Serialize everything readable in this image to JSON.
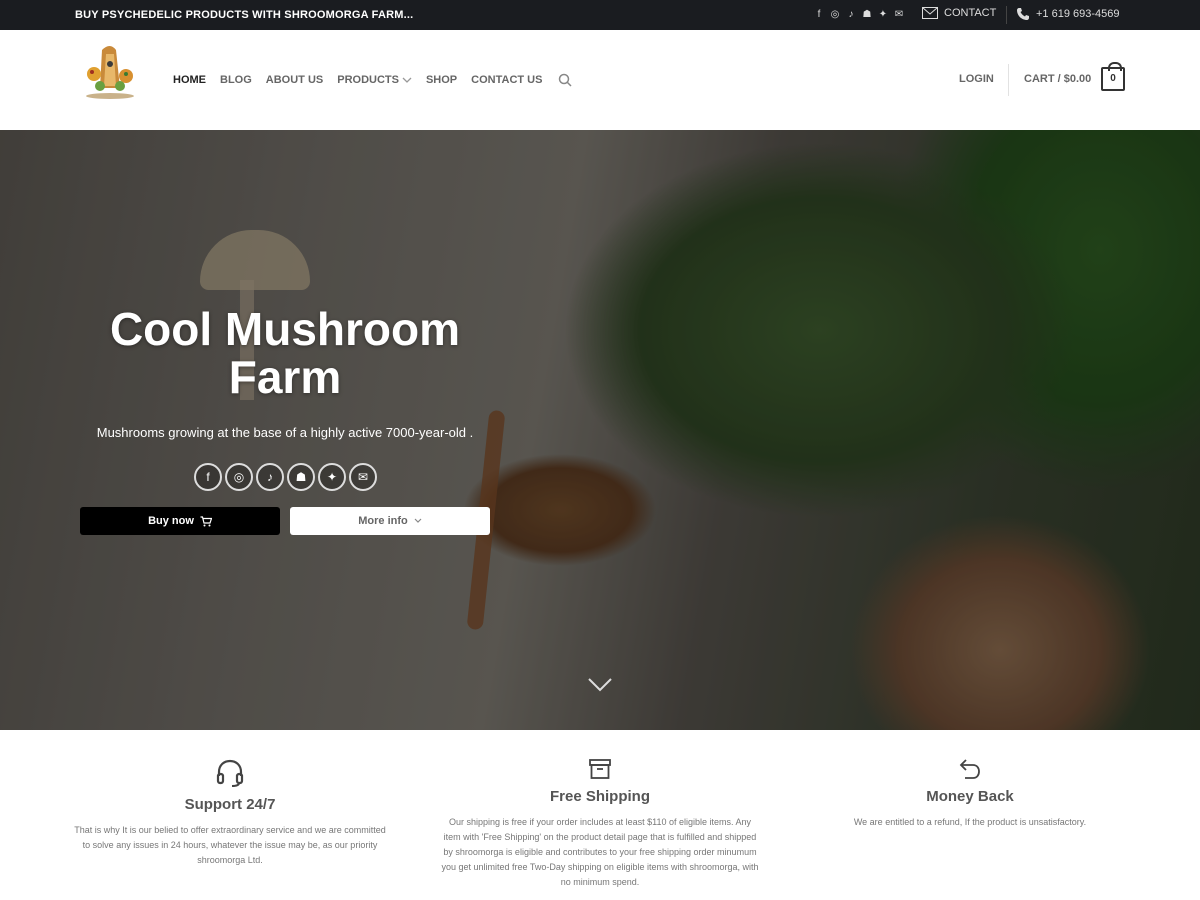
{
  "topbar": {
    "promo": "BUY PSYCHEDELIC PRODUCTS WITH SHROOMORGA FARM...",
    "socials": [
      "facebook-icon",
      "instagram-icon",
      "tiktok-icon",
      "snapchat-icon",
      "twitter-icon",
      "email-icon"
    ],
    "contact_label": "CONTACT",
    "phone": "+1 619 693-4569"
  },
  "header": {
    "nav": [
      "HOME",
      "BLOG",
      "ABOUT US",
      "PRODUCTS",
      "SHOP",
      "CONTACT US"
    ],
    "login": "LOGIN",
    "cart_label": "CART / $0.00",
    "cart_count": "0"
  },
  "hero": {
    "title": "Cool Mushroom Farm",
    "subtitle": "Mushrooms  growing at the base of a highly active 7000-year-old .",
    "buy_label": "Buy now",
    "more_label": "More info"
  },
  "features": [
    {
      "title": "Support 24/7",
      "text": "That is why It is our belied to offer extraordinary service and we are committed to solve any issues in 24 hours, whatever the issue may be, as our priority shroomorga Ltd."
    },
    {
      "title": "Free Shipping",
      "text": "Our shipping is free if your order includes at least $110 of eligible items. Any item with 'Free Shipping' on the product detail page that is fulfilled and shipped by shroomorga is eligible and contributes to your free shipping order minumum you get unlimited free Two-Day shipping on eligible items with shroomorga, with no minimum spend."
    },
    {
      "title": "Money Back",
      "text": "We are entitled to a refund, If the product is unsatisfactory."
    }
  ],
  "colors": {
    "topbar": "#1a1c20",
    "accent": "#000000"
  }
}
